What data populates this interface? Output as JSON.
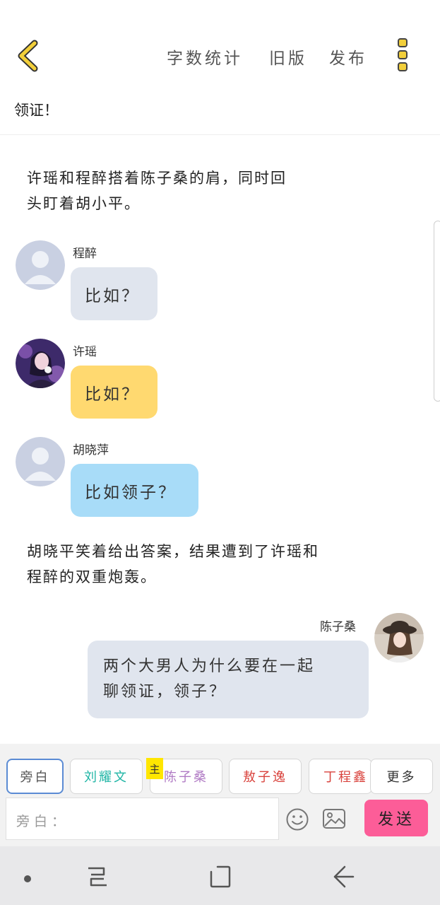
{
  "header": {
    "back_icon": "chevron-left-icon",
    "word_count_label": "字数统计",
    "old_version_label": "旧版",
    "publish_label": "发布",
    "menu_icon": "more-vertical-icon",
    "accent_color": "#f2cf3a"
  },
  "chapter": {
    "title": "领证！"
  },
  "story": {
    "narration_1": {
      "lines": [
        "许瑶和程醉搭着陈子桑的肩，同时回",
        "头盯着胡小平。"
      ]
    },
    "messages": [
      {
        "speaker": "程醉",
        "text": "比如？",
        "bubble_color": "#e0e5ee",
        "avatar": "default-avatar-icon"
      },
      {
        "speaker": "许瑶",
        "text": "比如？",
        "bubble_color": "#ffd970",
        "avatar": "girl-photo-avatar"
      },
      {
        "speaker": "胡晓萍",
        "text": "比如领子？",
        "bubble_color": "#a8dcf8",
        "avatar": "default-avatar-icon"
      }
    ],
    "narration_2": {
      "lines": [
        "胡晓平笑着给出答案，结果遭到了许瑶和",
        "程醉的双重炮轰。"
      ]
    },
    "right_message": {
      "speaker": "陈子桑",
      "lines": [
        "两个大男人为什么要在一起",
        "聊领证，领子？"
      ],
      "bubble_color": "#e0e5ee",
      "avatar": "girl-hat-photo-avatar"
    }
  },
  "composer": {
    "characters": [
      {
        "label": "旁白",
        "color": "#555555",
        "active": true
      },
      {
        "label": "刘耀文",
        "color": "#1fb5a5",
        "active": false
      },
      {
        "label": "陈子桑",
        "color": "#b07ac4",
        "active": false
      },
      {
        "label": "敖子逸",
        "color": "#d9433d",
        "active": false
      },
      {
        "label": "丁程鑫",
        "color": "#d9433d",
        "active": false
      }
    ],
    "main_badge": "主",
    "more_label": "更多",
    "input_placeholder": "旁白：",
    "emoji_icon": "smiley-icon",
    "image_icon": "image-icon",
    "send_label": "发送",
    "send_color": "#fc5d98"
  },
  "system_nav": {
    "dot_icon": "nav-dot-icon",
    "recents_icon": "recent-apps-icon",
    "home_icon": "home-square-icon",
    "back_icon": "nav-back-arrow-icon"
  }
}
